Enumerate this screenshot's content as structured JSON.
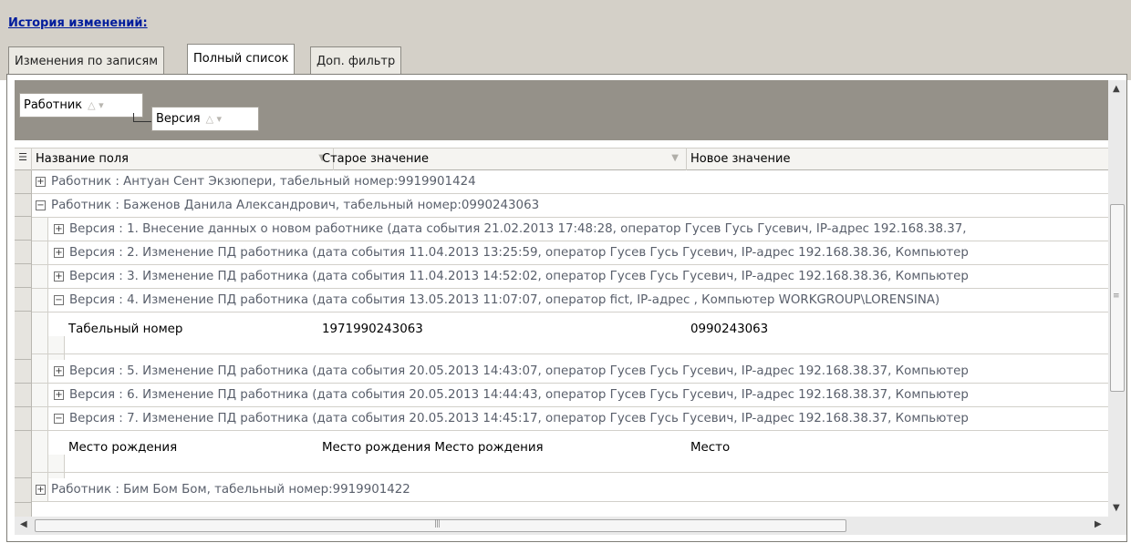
{
  "title": "История изменений:",
  "tabs": [
    {
      "label": "Изменения по записям",
      "active": false
    },
    {
      "label": "Полный список",
      "active": true
    },
    {
      "label": "Доп. фильтр",
      "active": false
    }
  ],
  "group_panel": {
    "chips": [
      "Работник",
      "Версия"
    ]
  },
  "columns": [
    "Название поля",
    "Старое значение",
    "Новое значение"
  ],
  "rows": [
    {
      "type": "group",
      "level": 0,
      "expanded": false,
      "text": "Работник : Антуан Сент Экзюпери, табельный номер:9919901424"
    },
    {
      "type": "group",
      "level": 0,
      "expanded": true,
      "text": "Работник : Баженов Данила Александрович, табельный номер:0990243063"
    },
    {
      "type": "group",
      "level": 1,
      "expanded": false,
      "text": "Версия : 1. Внесение данных о новом работнике (дата события 21.02.2013 17:48:28, оператор Гусев Гусь Гусевич, IP-адрес 192.168.38.37,"
    },
    {
      "type": "group",
      "level": 1,
      "expanded": false,
      "text": "Версия : 2. Изменение ПД работника (дата события 11.04.2013 13:25:59, оператор Гусев Гусь Гусевич, IP-адрес 192.168.38.36, Компьютер"
    },
    {
      "type": "group",
      "level": 1,
      "expanded": false,
      "text": "Версия : 3. Изменение ПД работника (дата события 11.04.2013 14:52:02, оператор Гусев Гусь Гусевич, IP-адрес 192.168.38.36, Компьютер"
    },
    {
      "type": "group",
      "level": 1,
      "expanded": true,
      "text": "Версия : 4. Изменение ПД работника (дата события 13.05.2013 11:07:07, оператор fict, IP-адрес , Компьютер WORKGROUP\\LORENSINA)"
    },
    {
      "type": "data",
      "field": "Табельный номер",
      "old": "1971990243063",
      "new": "0990243063"
    },
    {
      "type": "group",
      "level": 1,
      "expanded": false,
      "text": "Версия : 5. Изменение ПД работника (дата события 20.05.2013 14:43:07, оператор Гусев Гусь Гусевич, IP-адрес 192.168.38.37, Компьютер"
    },
    {
      "type": "group",
      "level": 1,
      "expanded": false,
      "text": "Версия : 6. Изменение ПД работника (дата события 20.05.2013 14:44:43, оператор Гусев Гусь Гусевич, IP-адрес 192.168.38.37, Компьютер"
    },
    {
      "type": "group",
      "level": 1,
      "expanded": true,
      "text": "Версия : 7. Изменение ПД работника (дата события 20.05.2013 14:45:17, оператор Гусев Гусь Гусевич, IP-адрес 192.168.38.37, Компьютер"
    },
    {
      "type": "data",
      "field": "Место рождения",
      "old": "Место рождения Место рождения",
      "new": "Место"
    },
    {
      "type": "group",
      "level": 0,
      "expanded": false,
      "text": "Работник : Бим Бом Бом, табельный номер:9919901422"
    }
  ],
  "colors": {
    "link": "#001c9c",
    "group_text": "#595f6b",
    "panel": "#959189"
  }
}
